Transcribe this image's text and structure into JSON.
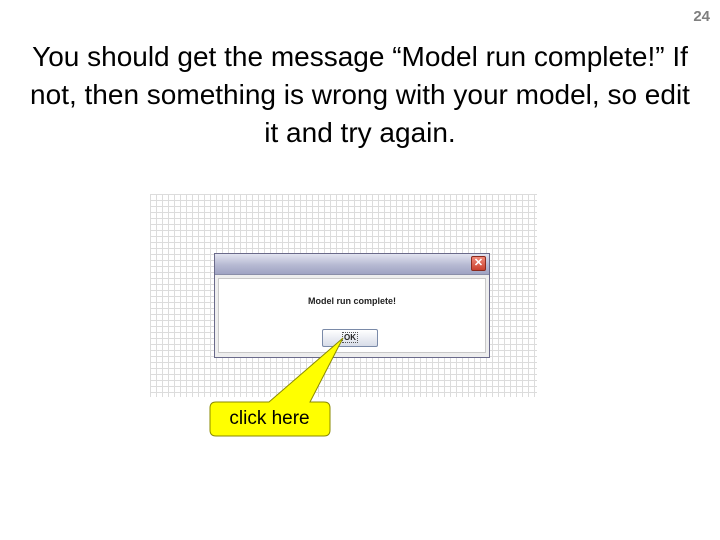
{
  "slide": {
    "number": "24",
    "title": "You should get the message “Model run complete!” If not, then something is wrong with your model, so edit it and try again."
  },
  "dialog": {
    "message": "Model run complete!",
    "ok_label": "OK",
    "close_glyph": "✕"
  },
  "callout": {
    "label": "click here",
    "fill": "#ffff00",
    "stroke": "#8a8a00"
  }
}
